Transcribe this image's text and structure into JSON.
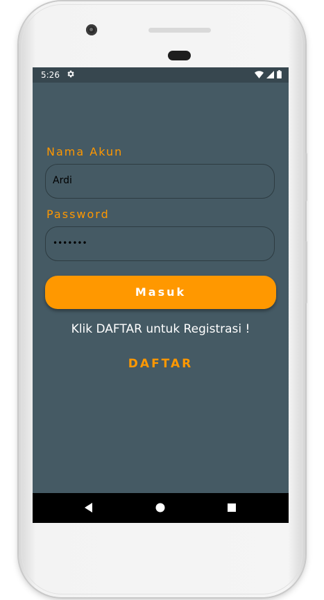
{
  "status_bar": {
    "time": "5:26",
    "icons": [
      "gear-icon",
      "wifi-icon",
      "signal-icon",
      "battery-icon"
    ]
  },
  "form": {
    "username_label": "Nama Akun",
    "username_value": "Ardi",
    "password_label": "Password",
    "password_value": "•••••••",
    "login_button_label": "Masuk"
  },
  "register": {
    "hint_text": "Klik DAFTAR untuk Registrasi !",
    "link_label": "DAFTAR"
  },
  "nav_bar": {
    "icons": [
      "back-icon",
      "home-icon",
      "recents-icon"
    ]
  },
  "colors": {
    "accent": "#ff9800",
    "background": "#455a64",
    "status_bar": "#37474f",
    "nav_bar": "#000000"
  }
}
